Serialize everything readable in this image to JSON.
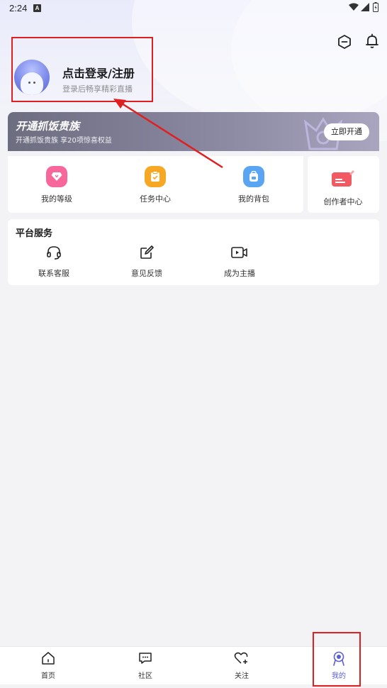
{
  "status_bar": {
    "time": "2:24",
    "notification_badge": "A"
  },
  "profile": {
    "login_title": "点击登录/注册",
    "login_subtitle": "登录后畅享精彩直播"
  },
  "vip_banner": {
    "title": "开通抓饭贵族",
    "subtitle": "开通抓饭贵族 享20项惊喜权益",
    "button_label": "立即开通"
  },
  "quick_actions": [
    {
      "label": "我的等级",
      "icon": "diamond-icon",
      "color": "#f7679a"
    },
    {
      "label": "任务中心",
      "icon": "task-icon",
      "color": "#f7a823"
    },
    {
      "label": "我的背包",
      "icon": "backpack-icon",
      "color": "#5aa5f3"
    },
    {
      "label": "创作者中心",
      "icon": "creator-icon",
      "color": "#f25a63"
    }
  ],
  "platform_services": {
    "title": "平台服务",
    "items": [
      {
        "label": "联系客服",
        "icon": "headset-icon"
      },
      {
        "label": "意见反馈",
        "icon": "feedback-icon"
      },
      {
        "label": "成为主播",
        "icon": "video-icon"
      }
    ]
  },
  "bottom_nav": [
    {
      "label": "首页",
      "icon": "home-icon",
      "active": false
    },
    {
      "label": "社区",
      "icon": "community-icon",
      "active": false
    },
    {
      "label": "关注",
      "icon": "follow-icon",
      "active": false
    },
    {
      "label": "我的",
      "icon": "profile-icon",
      "active": true
    }
  ],
  "colors": {
    "accent": "#5a5fd6",
    "annotation": "#e02020"
  }
}
